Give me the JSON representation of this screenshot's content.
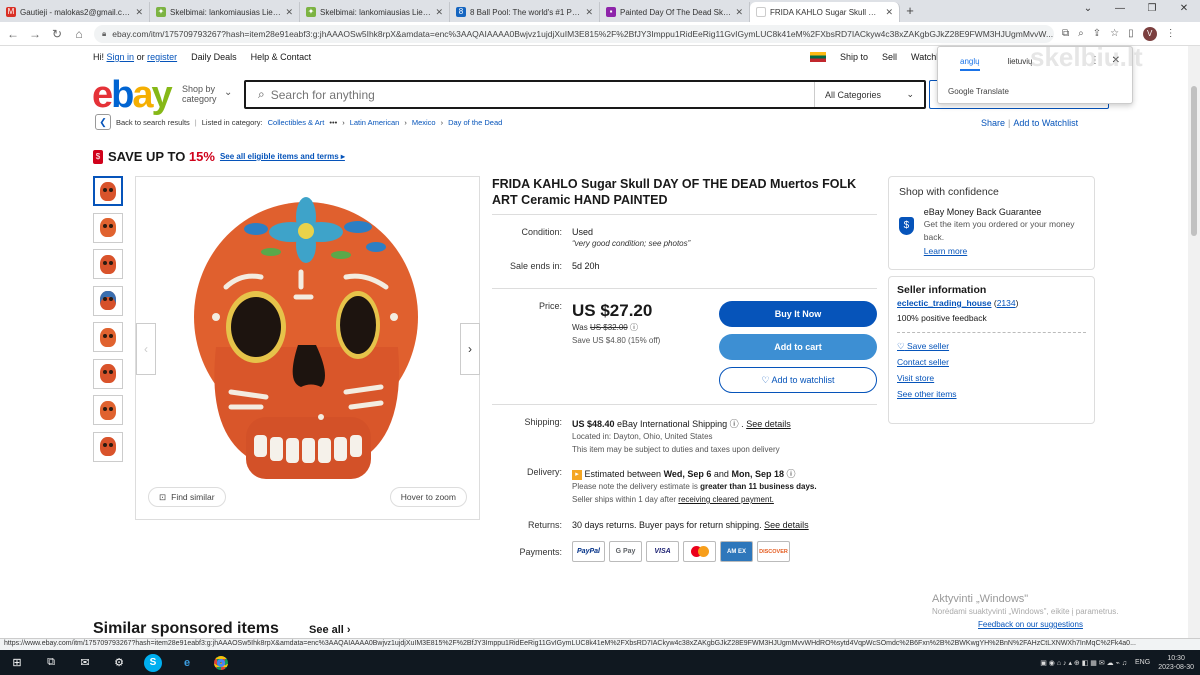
{
  "browser": {
    "tabs": [
      {
        "title": "Gautieji - malokas2@gmail.com",
        "icon": "gmail-icon",
        "color": "#d93025"
      },
      {
        "title": "Skelbimai: lankomiausias Lietuvo",
        "icon": "skelbiu-icon",
        "color": "#7cb342"
      },
      {
        "title": "Skelbimai: lankomiausias Lietuvo",
        "icon": "skelbiu-icon",
        "color": "#7cb342"
      },
      {
        "title": "8 Ball Pool: The world's #1 Pool g",
        "icon": "game-icon",
        "color": "#1565c0"
      },
      {
        "title": "Painted Day Of The Dead Skulls f",
        "icon": "page-icon",
        "color": "#8e24aa"
      },
      {
        "title": "FRIDA KAHLO Sugar Skull DAY O",
        "icon": "ebay-icon",
        "color": "#e53238"
      }
    ],
    "new_tab": "+",
    "url": "ebay.com/itm/175709793267?hash=item28e91eabf3:g:jhAAAOSw5Ihk8rpX&amdata=enc%3AAQAIAAAA0Bwjvz1ujdjXuIM3E815%2F%2BfJY3Imppu1RidEeRig11GvIGymLUC8k41eM%2FXbsRD7IACkyw4c38xZAKgbGJkZ28E9FWM3HJUgmMvvW...",
    "avatar": "V"
  },
  "translate_popup": {
    "lang_source": "anglų",
    "lang_target": "lietuvių",
    "label": "Google Translate",
    "more": "⋮",
    "close": "✕"
  },
  "watermark": "skelbiu.lt",
  "header": {
    "greeting": "Hi!",
    "sign_in": "Sign in",
    "or": "or",
    "register": "register",
    "daily_deals": "Daily Deals",
    "help_contact": "Help & Contact",
    "ship_to": "Ship to",
    "sell": "Sell",
    "watchlist": "Watchli"
  },
  "logo": {
    "e": "e",
    "b": "b",
    "a": "a",
    "y": "y"
  },
  "shop_by": {
    "line1": "Shop by",
    "line2": "category"
  },
  "search": {
    "placeholder": "Search for anything",
    "category": "All Categories"
  },
  "breadcrumb": {
    "back": "Back to search results",
    "listed": "Listed in category:",
    "items": [
      "Collectibles & Art",
      "•••",
      "Latin American",
      "Mexico",
      "Day of the Dead"
    ]
  },
  "share": {
    "share": "Share",
    "sep": "|",
    "watchlist": "Add to Watchlist"
  },
  "promo": {
    "text": "SAVE UP TO ",
    "pct": "15%",
    "link": "See all eligible items and terms ▸",
    "tag": "$"
  },
  "gallery": {
    "find_similar": "Find similar",
    "hover_zoom": "Hover to zoom",
    "thumb_count": 8
  },
  "item": {
    "title": "FRIDA KAHLO Sugar Skull DAY OF THE DEAD Muertos FOLK ART Ceramic HAND PAINTED",
    "condition_label": "Condition:",
    "condition": "Used",
    "condition_note": "“very good condition; see photos”",
    "sale_ends_label": "Sale ends in:",
    "sale_ends": "5d 20h",
    "price_label": "Price:",
    "price": "US $27.20",
    "was_label": "Was",
    "was": "US $32.00",
    "save": "Save US $4.80 (15% off)",
    "buy_now": "Buy It Now",
    "add_cart": "Add to cart",
    "add_watch": "♡ Add to watchlist"
  },
  "shipping": {
    "label": "Shipping:",
    "amount": "US $48.40",
    "method": "eBay International Shipping",
    "see_details": "See details",
    "location": "Located in: Dayton, Ohio, United States",
    "duties": "This item may be subject to duties and taxes upon delivery",
    "delivery_label": "Delivery:",
    "delivery_pre": "Estimated between ",
    "delivery_dates": "Wed, Sep 6",
    "delivery_and": " and ",
    "delivery_end": "Mon, Sep 18",
    "delivery_note_pre": "Please note the delivery estimate is ",
    "delivery_note_bold": "greater than 11 business days.",
    "ships_within_pre": "Seller ships within 1 day after ",
    "ships_within_link": "receiving cleared payment.",
    "returns_label": "Returns:",
    "returns": "30 days returns. Buyer pays for return shipping.",
    "returns_link": "See details",
    "payments_label": "Payments:",
    "payments": [
      {
        "name": "PayPal",
        "color": "#003087",
        "bg": "#fff"
      },
      {
        "name": "G Pay",
        "color": "#5f6368",
        "bg": "#fff"
      },
      {
        "name": "VISA",
        "color": "#1a1f71",
        "bg": "#fff"
      },
      {
        "name": "●●",
        "color": "#eb001b",
        "bg": "#fff"
      },
      {
        "name": "AM EX",
        "color": "#fff",
        "bg": "#2e77bb"
      },
      {
        "name": "DISCOVER",
        "color": "#e55c20",
        "bg": "#fff"
      }
    ]
  },
  "confidence": {
    "title": "Shop with confidence",
    "guarantee": "eBay Money Back Guarantee",
    "desc": "Get the item you ordered or your money back.",
    "learn": "Learn more"
  },
  "seller": {
    "title": "Seller information",
    "name": "eclectic_trading_house",
    "score": "2134",
    "feedback": "100% positive feedback",
    "save": "Save seller",
    "contact": "Contact seller",
    "store": "Visit store",
    "other": "See other items"
  },
  "similar": {
    "title": "Similar sponsored items",
    "see_all": "See all"
  },
  "windows": {
    "activate": "Aktyvinti „Windows\"",
    "activate_sub": "Norėdami suaktyvinti „Windows\", eikite į parametrus.",
    "feedback": "Feedback on our suggestions",
    "status_url": "https://www.ebay.com/itm/175709793267?hash=item28e91eabf3:g:jhAAAOSw5Ihk8rpX&amdata=enc%3AAQAIAAAA0Bwjvz1ujdjXuIM3E815%2F%2BfJY3Imppu1RidEeRig11GvIGymLUC8k41eM%2FXbsRD7IACkyw4c38xZAKgbGJkZ28E9FWM3HJUgmMvvWHdRO%sytd4VqpWcSOmdc%2B6Fxn%2B%2BWKwgYH%2BnN%2FAHzCtLXNWXh7InMqC%2Fk4a0...",
    "lang": "ENG",
    "time": "10:30",
    "date": "2023-08-30"
  }
}
